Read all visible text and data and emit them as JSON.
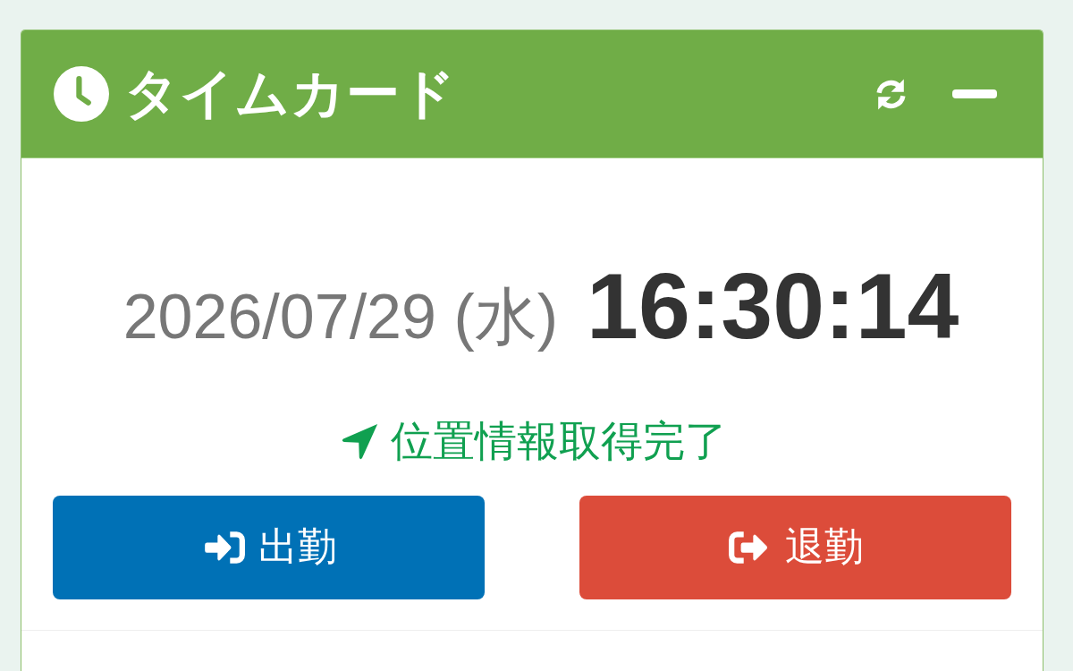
{
  "panel": {
    "title": "タイムカード"
  },
  "clock": {
    "date": "2026/07/29 (水)",
    "time": "16:30:14"
  },
  "location_status": "位置情報取得完了",
  "buttons": [
    {
      "label": "出勤",
      "kind": "clock_in"
    },
    {
      "label": "退勤",
      "kind": "clock_out"
    }
  ]
}
